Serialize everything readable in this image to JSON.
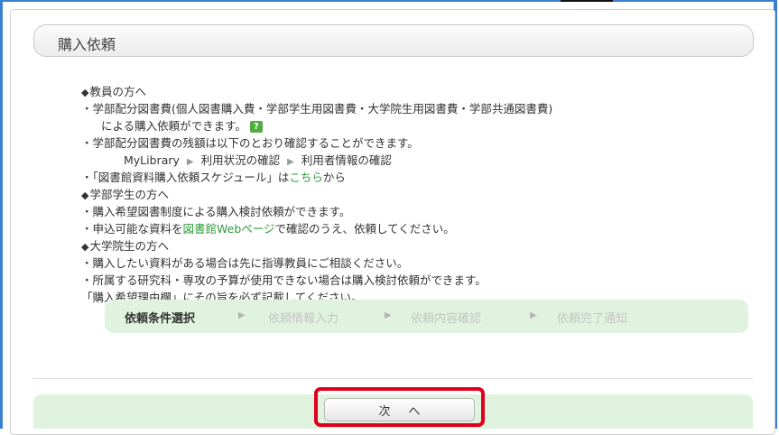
{
  "title": "購入依頼",
  "faculty": {
    "heading": "教員の方へ",
    "item1_line1": "・学部配分図書費(個人図書購入費・学部学生用図書費・大学院生用図書費・学部共通図書費)",
    "item1_line2": "による購入依頼ができます。",
    "help_icon": "?",
    "item2": "・学部配分図書費の残額は以下のとおり確認することができます。",
    "path": [
      "MyLibrary",
      "利用状況の確認",
      "利用者情報の確認"
    ],
    "path_separator": "▶",
    "item3_pre": "・「図書館資料購入依頼スケジュール」は",
    "item3_link": "こちら",
    "item3_post": "から"
  },
  "undergrad": {
    "heading": "学部学生の方へ",
    "item1": "・購入希望図書制度による購入検討依頼ができます。",
    "item2_pre": "・申込可能な資料を",
    "item2_link": "図書館Webページ",
    "item2_post": "で確認のうえ、依頼してください。"
  },
  "grad": {
    "heading": "大学院生の方へ",
    "item1": "・購入したい資料がある場合は先に指導教員にご相談ください。",
    "item2": "・所属する研究科・専攻の予算が使用できない場合は購入検討依頼ができます。",
    "item3": "「購入希望理由欄」にその旨を必ず記載してください。"
  },
  "steps": [
    "依頼条件選択",
    "依頼情報入力",
    "依頼内容確認",
    "依頼完了通知"
  ],
  "step_separator": "▶",
  "next_button": "次へ"
}
